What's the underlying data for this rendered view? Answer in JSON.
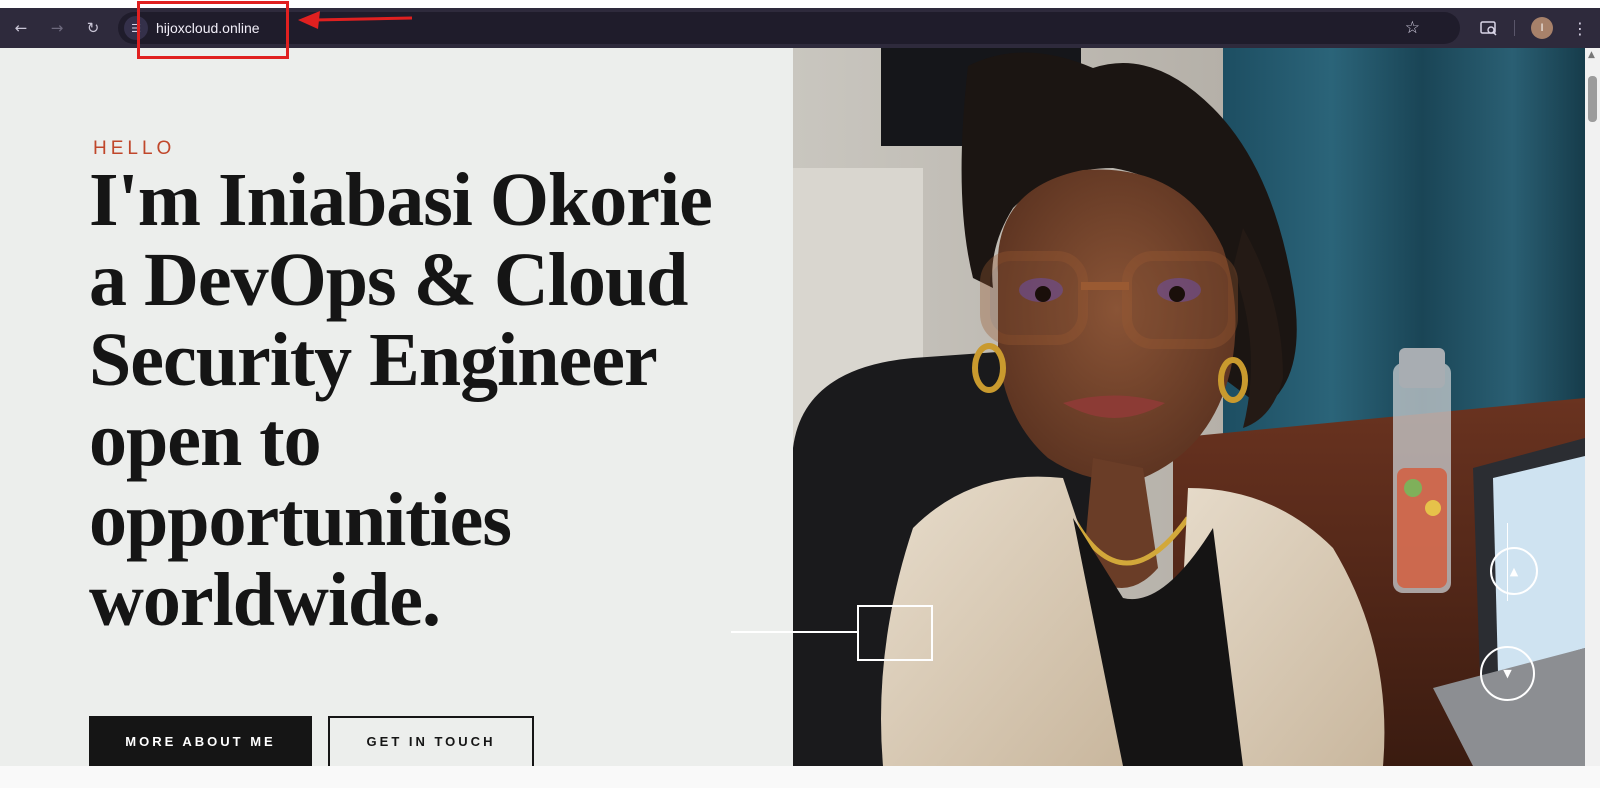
{
  "browser": {
    "url": "hijoxcloud.online",
    "back_icon": "arrow-left-icon",
    "forward_icon": "arrow-right-icon",
    "reload_icon": "reload-icon",
    "bookmark_icon": "star-icon",
    "profile_initial": "I",
    "colors": {
      "toolbar": "#2e2a3c",
      "omnibox": "#1f1c2b",
      "highlight": "#e02020"
    }
  },
  "hero": {
    "eyebrow": "HELLO",
    "headline_lines": [
      "I'm Iniabasi Okorie",
      "a DevOps & Cloud",
      "Security Engineer",
      "open to",
      "opportunities",
      "worldwide."
    ],
    "primary_button": "MORE ABOUT ME",
    "secondary_button": "GET IN TOUCH",
    "colors": {
      "accent": "#c0472b",
      "text": "#151515",
      "left_bg": "#eceeec"
    }
  }
}
